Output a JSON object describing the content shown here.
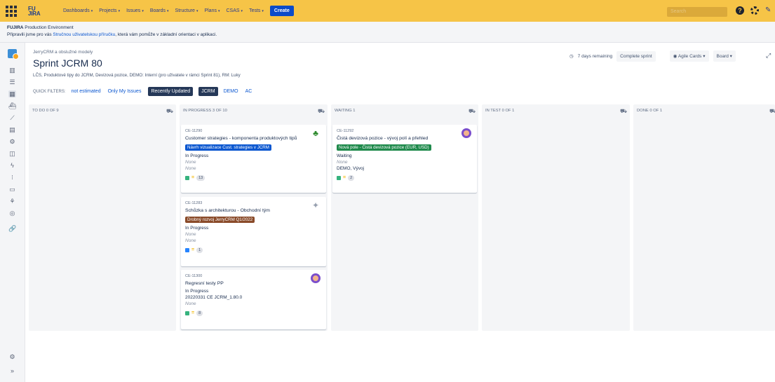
{
  "nav": {
    "logo_top": "FU",
    "logo_bottom": "JIRA",
    "items": [
      "Dashboards",
      "Projects",
      "Issues",
      "Boards",
      "Structure",
      "Plans",
      "CSAS",
      "Tests"
    ],
    "create": "Create",
    "search_placeholder": "Search"
  },
  "banner": {
    "title_bold": "FUJIRA",
    "title_rest": " Production Environment",
    "line_pre": "Připravili jsme pro vás ",
    "line_link": "Stručnou uživatelskou příručku",
    "line_post": ", která vám pomůže v základní orientaci v aplikaci."
  },
  "header": {
    "breadcrumb": "JerryCRM a obslužné modely",
    "title": "Sprint JCRM 80",
    "description": "LČS, Produktové tipy do JCRM, Devizová pozice, DEMO: Interní (pro uživatele v rámci Sprint 81), RM: Luky",
    "remaining": "7 days remaining",
    "complete_sprint": "Complete sprint",
    "agile_cards": "Agile Cards",
    "board": "Board"
  },
  "quick_filters": {
    "label": "QUICK FILTERS:",
    "items": [
      "not estimated",
      "Only My Issues",
      "Recently Updated",
      "JCRM",
      "DEMO",
      "AC"
    ]
  },
  "columns": [
    {
      "title": "TO DO 0 OF 9"
    },
    {
      "title": "IN PROGRESS 3 OF 10"
    },
    {
      "title": "WAITING 1"
    },
    {
      "title": "IN TEST 0 OF 1"
    },
    {
      "title": "DONE 0 OF 1"
    }
  ],
  "cards": [
    {
      "key": "CE-11290",
      "summary": "Customer strategies - komponenta produktových tipů",
      "epic": "Návrh vizualizace Cust. strategies v JCRM",
      "epic_color": "#0b57d0",
      "status": "In Progress",
      "f1": "None",
      "f2": "None",
      "points": "13",
      "type_color": "#36b37e",
      "avatar": "clover-icon"
    },
    {
      "key": "CE-11283",
      "summary": "Schůzka s architekturou - Obchodní tým",
      "epic": "Drobný rozvoj JerryCRM Q1/2022",
      "epic_color": "#8a4b2a",
      "status": "In Progress",
      "f1": "None",
      "f2": "None",
      "points": "1",
      "type_color": "#2684ff",
      "avatar": "unassigned-icon"
    },
    {
      "key": "CE-11300",
      "summary": "Regresní testy PP",
      "status": "In Progress",
      "f1": "20220331 CE JCRM_1.80.0",
      "f2": "None",
      "points": "8",
      "type_color": "#36b37e",
      "avatar": "owl-avatar"
    },
    {
      "key": "CE-11292",
      "summary": "Čistá devizová pozice - vývoj polí a přehled",
      "epic": "Nová pole - Čistá devizová pozice (EUR, USD)",
      "epic_color": "#1f8a4c",
      "status": "Waiting",
      "f1": "None",
      "f2": "DEMO, Vývoj",
      "points": "2",
      "type_color": "#36b37e",
      "avatar": "owl-avatar"
    }
  ]
}
